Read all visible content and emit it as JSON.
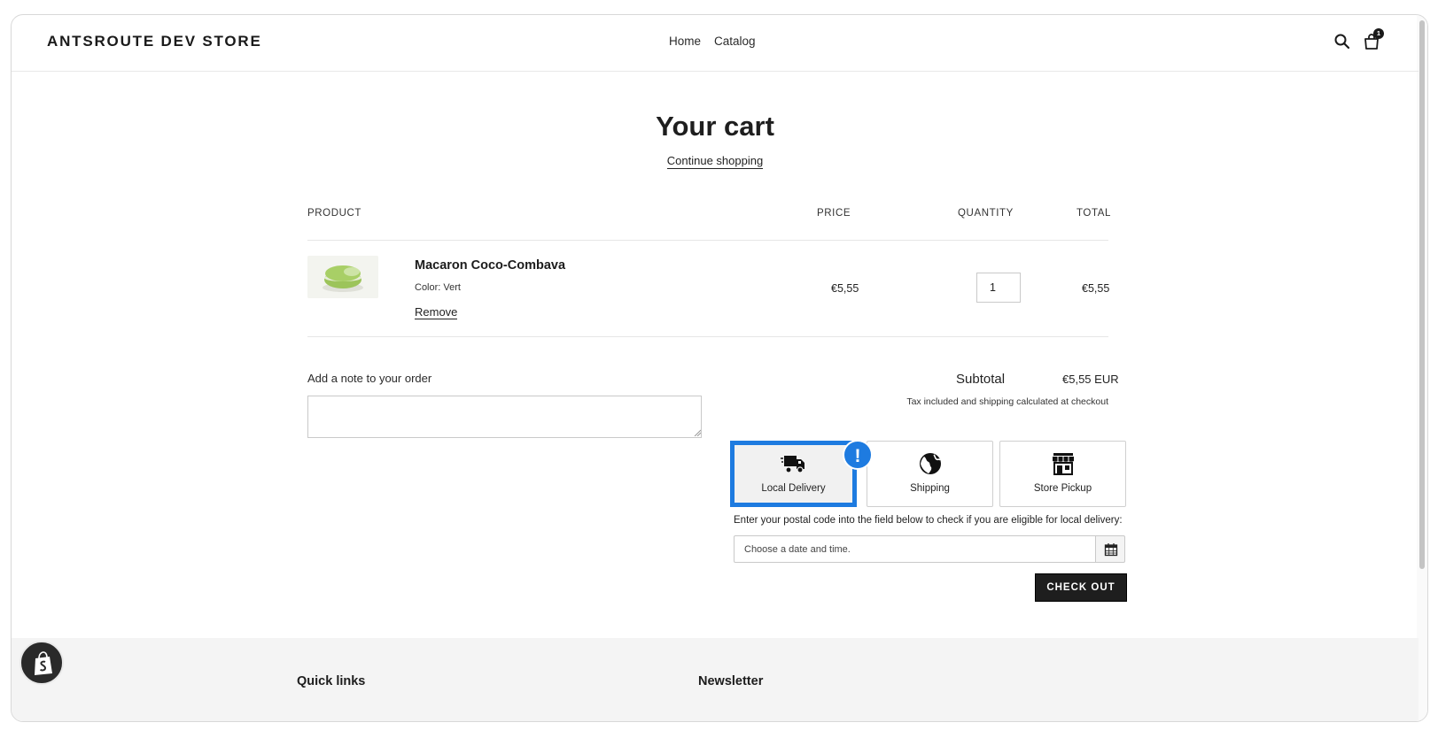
{
  "store": {
    "name": "ANTSROUTE DEV STORE"
  },
  "nav": {
    "items": [
      "Home",
      "Catalog"
    ]
  },
  "header": {
    "cart_count": "1",
    "icons": [
      "search-icon",
      "cart-icon"
    ]
  },
  "cart": {
    "title": "Your cart",
    "continue_label": "Continue shopping",
    "columns": {
      "product": "PRODUCT",
      "price": "PRICE",
      "quantity": "QUANTITY",
      "total": "TOTAL"
    },
    "items": [
      {
        "name": "Macaron Coco-Combava",
        "variant": "Color: Vert",
        "remove_label": "Remove",
        "price": "€5,55",
        "quantity": "1",
        "total": "€5,55"
      }
    ],
    "note_label": "Add a note to your order",
    "subtotal_label": "Subtotal",
    "subtotal_value": "€5,55 EUR",
    "tax_note": "Tax included and shipping calculated at checkout",
    "checkout_label": "CHECK OUT"
  },
  "delivery": {
    "methods": [
      {
        "label": "Local Delivery",
        "icon": "truck-icon",
        "selected": true
      },
      {
        "label": "Shipping",
        "icon": "globe-icon",
        "selected": false
      },
      {
        "label": "Store Pickup",
        "icon": "store-icon",
        "selected": false
      }
    ],
    "alert_badge": "!",
    "hint": "Enter your postal code into the field below to check if you are eligible for local delivery:",
    "date_placeholder": "Choose a date and time."
  },
  "footer": {
    "quick_links_heading": "Quick links",
    "newsletter_heading": "Newsletter"
  },
  "colors": {
    "accent": "#1e7be0",
    "button": "#1e1e1e",
    "footer_bg": "#f4f4f4"
  }
}
